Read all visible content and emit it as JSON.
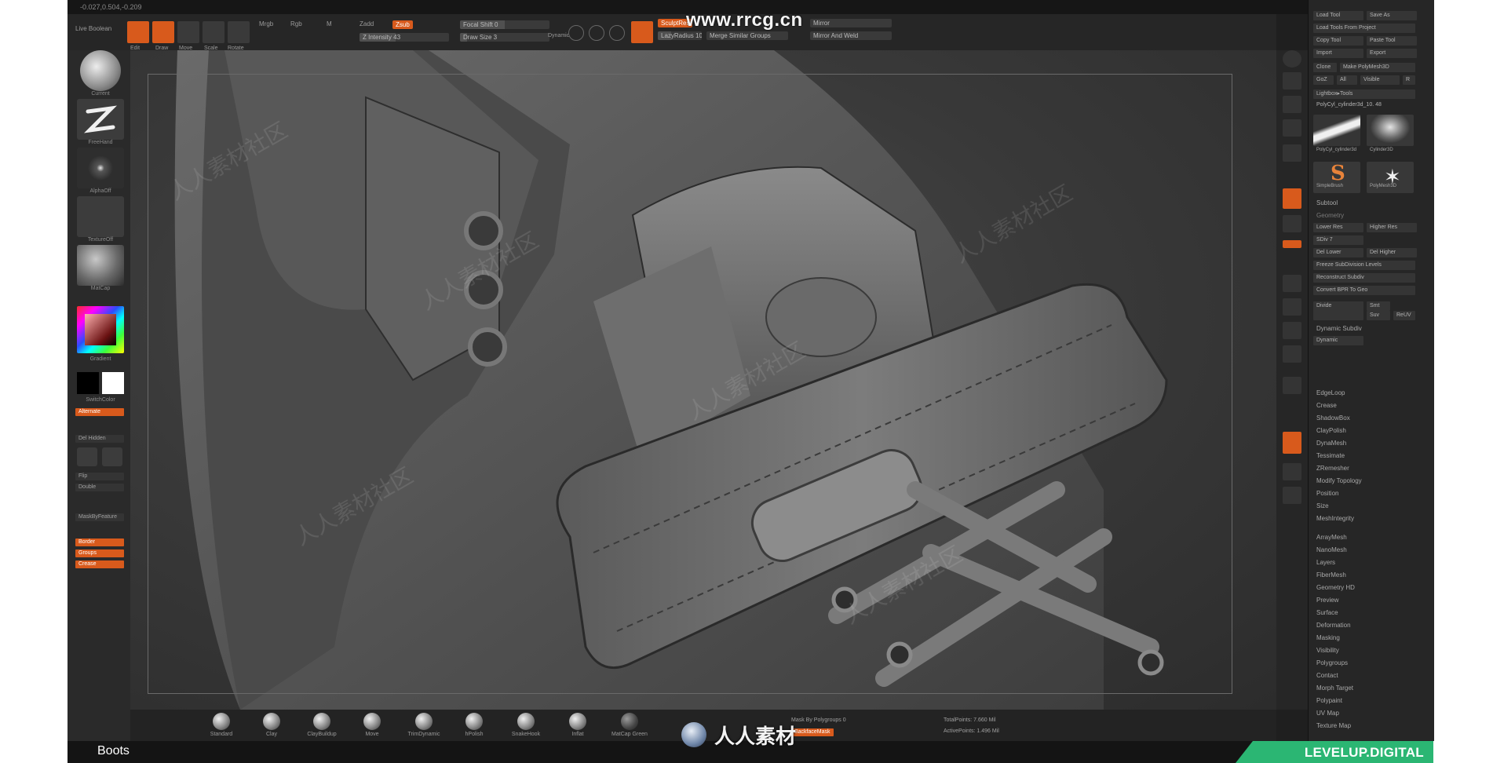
{
  "app": {
    "coords": "-0.027,0.504,-0.209",
    "watermark_top": "www.rrcg.cn",
    "document_title": "Boots",
    "brand_center": "人人素材",
    "brand_right": "LEVELUP.DIGITAL",
    "watermark_text": "人人素材社区"
  },
  "toolbar": {
    "live_boolean": "Live Boolean",
    "edit": "Edit",
    "draw": "Draw",
    "move": "Move",
    "scale": "Scale",
    "rotate": "Rotate",
    "mrgb": "Mrgb",
    "rgb": "Rgb",
    "m": "M",
    "zadd": "Zadd",
    "zsub": "Zsub",
    "z_intensity": "Z Intensity 43",
    "focal_shift": "Focal Shift 0",
    "draw_size": "Draw Size 3",
    "dynamic": "Dynamic",
    "smooth_chip": "SculptRes",
    "lazy_radius": "LazyRadius 10",
    "merge_similar": "Merge Similar Groups",
    "mirror": "Mirror",
    "mirror_and_weld": "Mirror And Weld"
  },
  "left_shelf": {
    "tile_labels": [
      "Current",
      "FreeHand",
      "AlphaOff",
      "TextureOff",
      "MatCap"
    ],
    "gradient": "Gradient",
    "switch_color": "SwitchColor",
    "alternate": "Alternate",
    "del_hidden": "Del Hidden",
    "flip": "Flip",
    "double": "Double",
    "mask_by_feature": "MaskByFeature",
    "border": "Border",
    "groups": "Groups",
    "crease": "Crease"
  },
  "right_panel": {
    "load_tool": "Load Tool",
    "save_as": "Save As",
    "load_tools_from_project": "Load Tools From Project",
    "copy_tool": "Copy Tool",
    "paste_tool": "Paste Tool",
    "import": "Import",
    "export": "Export",
    "clone": "Clone",
    "make_polymesh": "Make PolyMesh3D",
    "goz": "GoZ",
    "all": "All",
    "visible": "Visible",
    "r": "R",
    "lightbox_tools": "Lightbox▸Tools",
    "current_tool": "PolyCyl_cylinder3d_10.  48",
    "tool_thumbs": [
      "PolyCyl_cylinder3d",
      "Cylinder3D",
      "SimpleBrush",
      "PolyMesh3D",
      "PolyCyl_cylinder3d",
      ""
    ],
    "subtool": "Subtool",
    "geometry": "Geometry",
    "lower_res": "Lower Res",
    "higher_res": "Higher Res",
    "sdiv": "SDiv 7",
    "del_lower": "Del Lower",
    "del_higher": "Del Higher",
    "freeze": "Freeze SubDivision Levels",
    "reconstruct": "Reconstruct Subdiv",
    "convert_bpr": "Convert BPR To Geo",
    "divide": "Divide",
    "smt": "Smt",
    "suv": "Suv",
    "rel": "ReUV",
    "dynamic_subdiv": "Dynamic Subdiv",
    "dynamic": "Dynamic",
    "sections": [
      "EdgeLoop",
      "Crease",
      "ShadowBox",
      "ClayPolish",
      "DynaMesh",
      "Tessimate",
      "ZRemesher",
      "Modify Topology",
      "Position",
      "Size",
      "MeshIntegrity"
    ],
    "menus": [
      "ArrayMesh",
      "NanoMesh",
      "Layers",
      "FiberMesh",
      "Geometry HD",
      "Preview",
      "Surface",
      "Deformation",
      "Masking",
      "Visibility",
      "Polygroups",
      "Contact",
      "Morph Target",
      "Polypaint",
      "UV Map",
      "Texture Map"
    ]
  },
  "brushes": [
    "Standard",
    "Clay",
    "ClayBuildup",
    "Move",
    "TrimDynamic",
    "hPolish",
    "SnakeHook",
    "Inflat",
    "MatCap Green"
  ],
  "bottom_info": {
    "mask_by_polygroups": "Mask By Polygroups 0",
    "total_points": "TotalPoints: 7.660 Mil",
    "active_points": "ActivePoints: 1.496 Mil",
    "backface": "BackfaceMask"
  },
  "colors": {
    "accent": "#d85a1c",
    "brand_green": "#2bb673",
    "panel_bg": "#262626",
    "viewport_bg": "#3a3a3a"
  }
}
